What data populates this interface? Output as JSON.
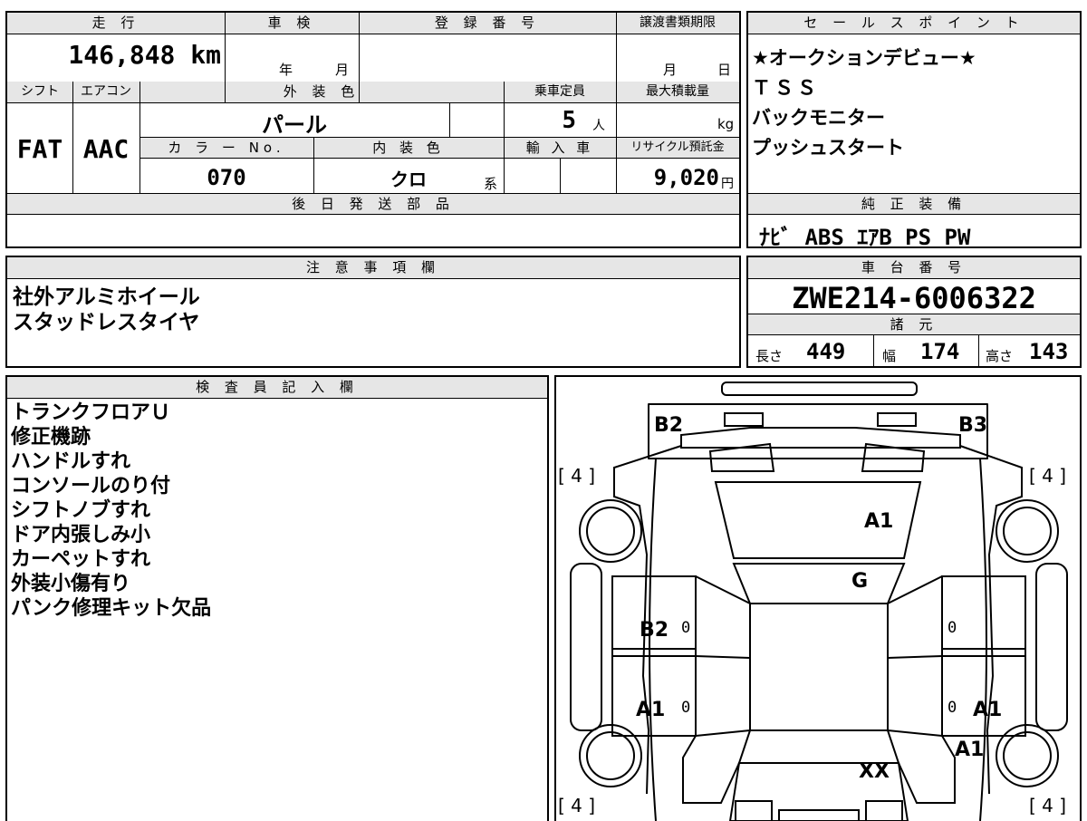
{
  "form": {
    "mileage_label": "走 行",
    "mileage_value": "146,848",
    "mileage_unit": "km",
    "inspection_label": "車 検",
    "inspection_year": "年",
    "inspection_month": "月",
    "registration_label": "登 録 番 号",
    "transfer_label": "譲渡書類期限",
    "transfer_month": "月",
    "transfer_day": "日",
    "shift_label": "シフト",
    "shift_value": "FAT",
    "ac_label": "エアコン",
    "ac_value": "AAC",
    "exterior_color_label": "外 装 色",
    "exterior_color_value": "パール",
    "capacity_label": "乗車定員",
    "capacity_value": "5",
    "capacity_unit": "人",
    "max_load_label": "最大積載量",
    "max_load_unit": "kg",
    "color_no_label": "カ ラ ー No.",
    "color_no_value": "070",
    "interior_color_label": "内 装 色",
    "interior_color_value": "クロ",
    "interior_color_suffix": "系",
    "import_label": "輸 入 車",
    "recycle_label": "リサイクル預託金",
    "recycle_value": "9,020",
    "recycle_unit": "円",
    "parts_later_label": "後 日 発 送 部 品"
  },
  "sales_points": {
    "label": "セ ー ル ス ポ イ ン ト",
    "items": [
      "★オークションデビュー★",
      "ＴＳＳ",
      "バックモニター",
      "プッシュスタート"
    ]
  },
  "equipment": {
    "label": "純 正 装 備",
    "value": "ﾅﾋﾞ ABS ｴｱB PS PW"
  },
  "notes": {
    "label": "注 意 事 項 欄",
    "items": [
      "社外アルミホイール",
      "スタッドレスタイヤ"
    ]
  },
  "chassis": {
    "label": "車 台 番 号",
    "value": "ZWE214-6006322"
  },
  "specs": {
    "label": "諸 元",
    "length_label": "長さ",
    "length_value": "449",
    "width_label": "幅",
    "width_value": "174",
    "height_label": "高さ",
    "height_value": "143"
  },
  "inspector": {
    "label": "検 査 員 記 入 欄",
    "items": [
      "トランクフロアＵ",
      "修正機跡",
      "ハンドルすれ",
      "コンソールのり付",
      "シフトノブすれ",
      "ドア内張しみ小",
      "カーペットすれ",
      "外装小傷有り",
      "パンク修理キット欠品"
    ]
  },
  "diagram": {
    "b2_top": "B2",
    "b3_top": "B3",
    "tread_fl": "[ 4 ]",
    "tread_fr": "[ 4 ]",
    "tread_rl": "[ 4 ]",
    "tread_rr": "[ 4 ]",
    "trunk_grade": "A1",
    "roof_grade": "G",
    "door_left_front": "B2",
    "door_left_rear": "A1",
    "door_right_rear": "A1",
    "fender_right": "A1",
    "hood_grade": "XX",
    "zero_1": "0",
    "zero_2": "0",
    "zero_3": "0",
    "zero_4": "0"
  }
}
